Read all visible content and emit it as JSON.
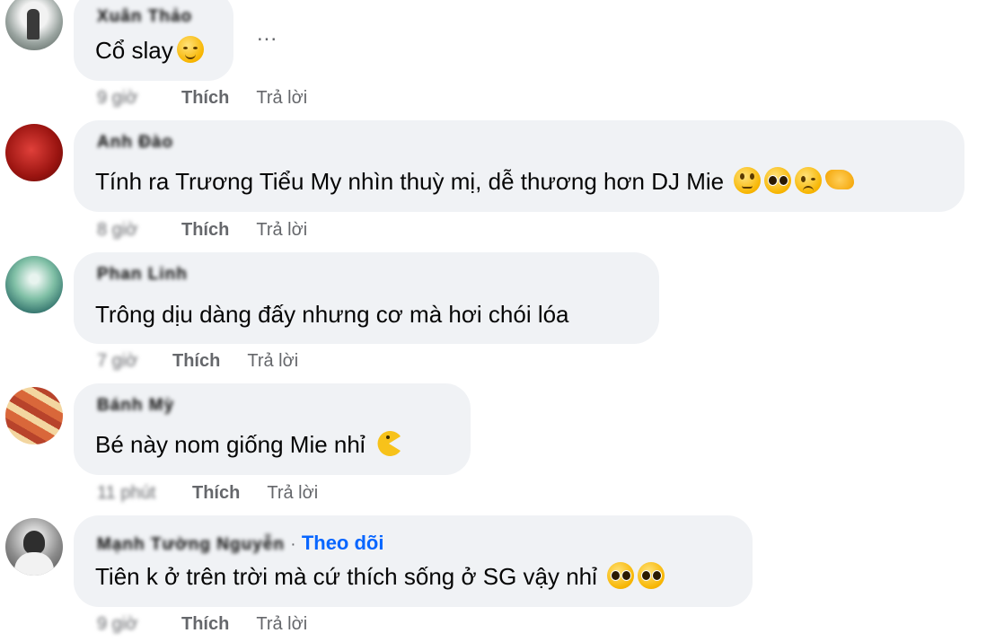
{
  "comments": [
    {
      "author": "Xuân Thảo",
      "text": "Cổ slay",
      "time": "9 giờ",
      "like": "Thích",
      "reply": "Trả lời",
      "more": "..."
    },
    {
      "author": "Anh Đào",
      "text": "Tính ra Trương Tiểu My nhìn thuỳ mị, dễ thương hơn DJ Mie",
      "time": "8 giờ",
      "like": "Thích",
      "reply": "Trả lời"
    },
    {
      "author": "Phan Linh",
      "text": "Trông dịu dàng đấy nhưng cơ mà hơi chói lóa",
      "time": "7 giờ",
      "like": "Thích",
      "reply": "Trả lời"
    },
    {
      "author": "Bánh Mỳ",
      "text": "Bé này nom giống Mie nhỉ",
      "time": "11 phút",
      "like": "Thích",
      "reply": "Trả lời"
    },
    {
      "author": "Mạnh Tường Nguyễn",
      "follow": "Theo dõi",
      "follow_sep": "·",
      "text": "Tiên k ở trên trời mà cứ thích sống ở SG vậy nhỉ",
      "time": "9 giờ",
      "like": "Thích",
      "reply": "Trả lời"
    }
  ],
  "colors": {
    "bubble": "#f0f2f5",
    "text": "#050505",
    "meta": "#65676b",
    "link": "#0866ff"
  }
}
